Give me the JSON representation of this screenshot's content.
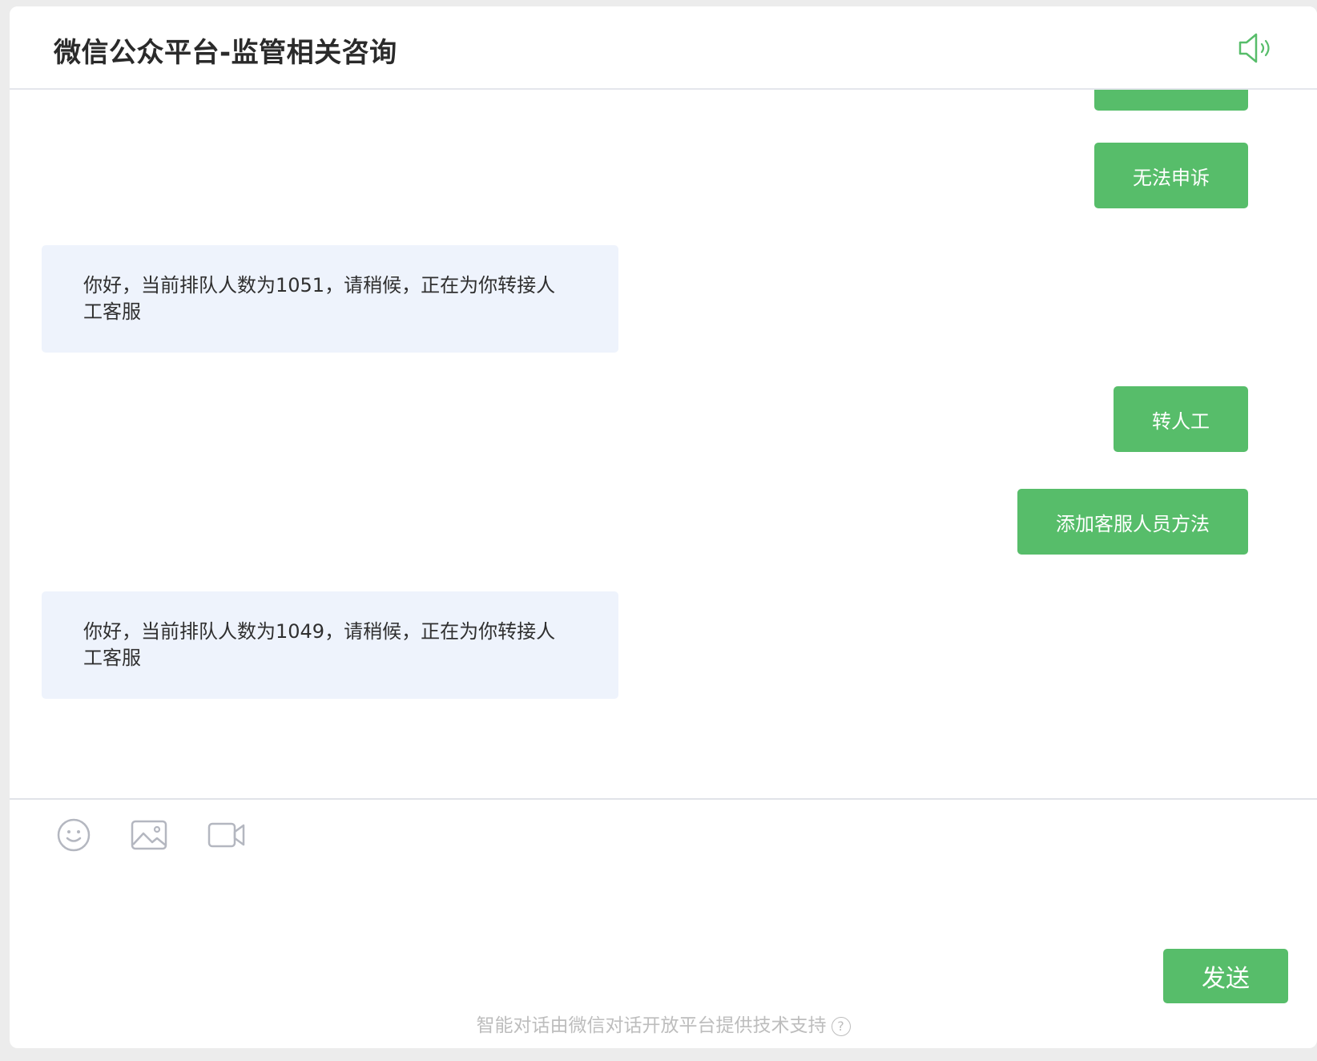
{
  "header": {
    "title": "微信公众平台-监管相关咨询",
    "speaker_icon": "speaker-icon"
  },
  "messages": [
    {
      "type": "outgoing",
      "text": ""
    },
    {
      "type": "outgoing",
      "text": "无法申诉"
    },
    {
      "type": "incoming",
      "text": "你好，当前排队人数为1051，请稍候，正在为你转接人工客服"
    },
    {
      "type": "outgoing",
      "text": "转人工"
    },
    {
      "type": "outgoing",
      "text": "添加客服人员方法"
    },
    {
      "type": "incoming",
      "text": "你好，当前排队人数为1049，请稍候，正在为你转接人工客服"
    }
  ],
  "toolbar": {
    "emoji_icon": "emoji-icon",
    "image_icon": "image-icon",
    "video_icon": "video-icon"
  },
  "composer": {
    "value": "",
    "send_label": "发送"
  },
  "footer": {
    "text": "智能对话由微信对话开放平台提供技术支持",
    "help_glyph": "?"
  },
  "colors": {
    "accent": "#57bd6a",
    "incoming_bubble": "#eef3fc",
    "icon_gray": "#b4b7c0"
  }
}
